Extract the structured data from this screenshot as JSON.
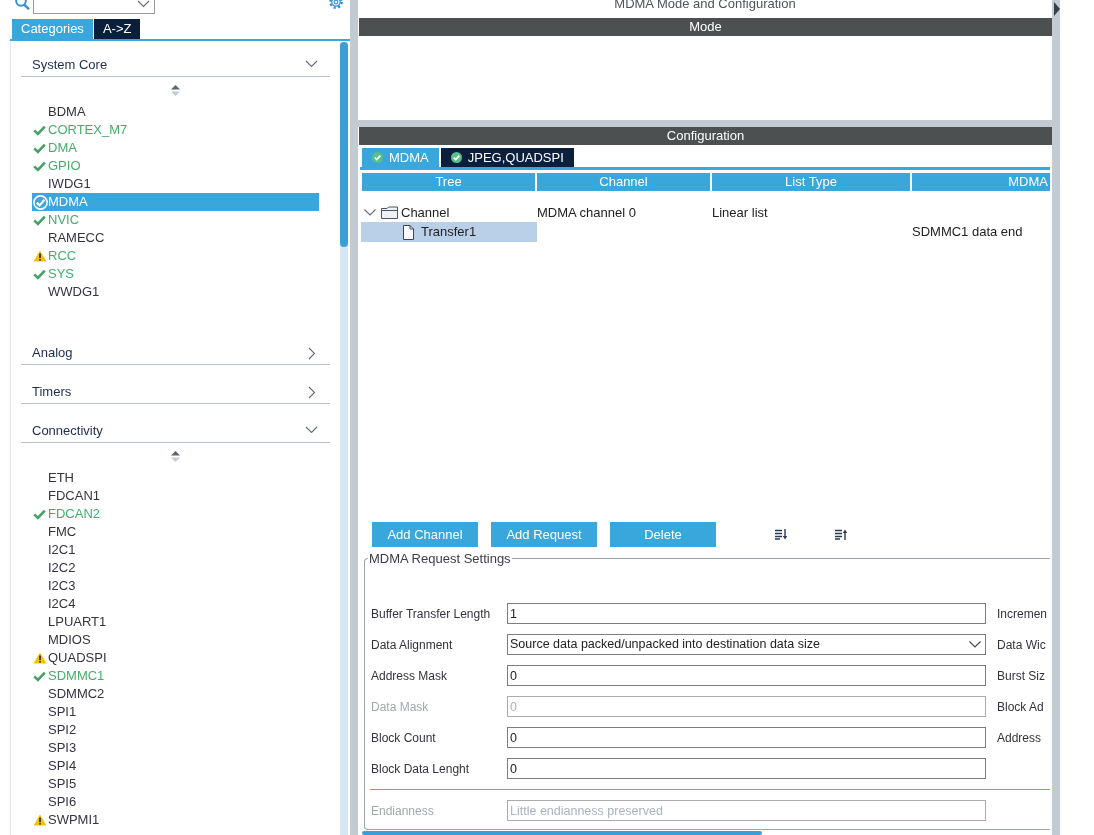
{
  "sidebar": {
    "tabs": [
      {
        "label": "Categories",
        "selected": true
      },
      {
        "label": "A->Z",
        "selected": false
      }
    ],
    "categories": [
      {
        "label": "System Core",
        "expanded": true,
        "items": [
          {
            "label": "BDMA",
            "checked": false,
            "warning": false,
            "configured": false,
            "selected": false
          },
          {
            "label": "CORTEX_M7",
            "checked": true,
            "warning": false,
            "configured": true,
            "selected": false
          },
          {
            "label": "DMA",
            "checked": true,
            "warning": false,
            "configured": true,
            "selected": false
          },
          {
            "label": "GPIO",
            "checked": true,
            "warning": false,
            "configured": true,
            "selected": false
          },
          {
            "label": "IWDG1",
            "checked": false,
            "warning": false,
            "configured": false,
            "selected": false
          },
          {
            "label": "MDMA",
            "checked": true,
            "warning": false,
            "configured": true,
            "selected": true
          },
          {
            "label": "NVIC",
            "checked": true,
            "warning": false,
            "configured": true,
            "selected": false
          },
          {
            "label": "RAMECC",
            "checked": false,
            "warning": false,
            "configured": false,
            "selected": false
          },
          {
            "label": "RCC",
            "warning": true,
            "configured": true,
            "selected": false
          },
          {
            "label": "SYS",
            "checked": true,
            "warning": false,
            "configured": true,
            "selected": false
          },
          {
            "label": "WWDG1",
            "checked": false,
            "warning": false,
            "configured": false,
            "selected": false
          }
        ]
      },
      {
        "label": "Analog",
        "expanded": false
      },
      {
        "label": "Timers",
        "expanded": false
      },
      {
        "label": "Connectivity",
        "expanded": true,
        "items": [
          {
            "label": "ETH",
            "checked": false,
            "warning": false,
            "configured": false,
            "selected": false
          },
          {
            "label": "FDCAN1",
            "checked": false,
            "warning": false,
            "configured": false,
            "selected": false
          },
          {
            "label": "FDCAN2",
            "checked": true,
            "warning": false,
            "configured": true,
            "selected": false
          },
          {
            "label": "FMC",
            "checked": false,
            "warning": false,
            "configured": false,
            "selected": false
          },
          {
            "label": "I2C1",
            "checked": false,
            "warning": false,
            "configured": false,
            "selected": false
          },
          {
            "label": "I2C2",
            "checked": false,
            "warning": false,
            "configured": false,
            "selected": false
          },
          {
            "label": "I2C3",
            "checked": false,
            "warning": false,
            "configured": false,
            "selected": false
          },
          {
            "label": "I2C4",
            "checked": false,
            "warning": false,
            "configured": false,
            "selected": false
          },
          {
            "label": "LPUART1",
            "checked": false,
            "warning": false,
            "configured": false,
            "selected": false
          },
          {
            "label": "MDIOS",
            "checked": false,
            "warning": false,
            "configured": false,
            "selected": false
          },
          {
            "label": "QUADSPI",
            "warning": true,
            "configured": false,
            "selected": false
          },
          {
            "label": "SDMMC1",
            "checked": true,
            "warning": false,
            "configured": true,
            "selected": false
          },
          {
            "label": "SDMMC2",
            "checked": false,
            "warning": false,
            "configured": false,
            "selected": false
          },
          {
            "label": "SPI1",
            "checked": false,
            "warning": false,
            "configured": false,
            "selected": false
          },
          {
            "label": "SPI2",
            "checked": false,
            "warning": false,
            "configured": false,
            "selected": false
          },
          {
            "label": "SPI3",
            "checked": false,
            "warning": false,
            "configured": false,
            "selected": false
          },
          {
            "label": "SPI4",
            "checked": false,
            "warning": false,
            "configured": false,
            "selected": false
          },
          {
            "label": "SPI5",
            "checked": false,
            "warning": false,
            "configured": false,
            "selected": false
          },
          {
            "label": "SPI6",
            "checked": false,
            "warning": false,
            "configured": false,
            "selected": false
          },
          {
            "label": "SWPMI1",
            "warning": true,
            "configured": false,
            "selected": false
          }
        ]
      }
    ]
  },
  "main": {
    "title": "MDMA Mode and Configuration",
    "mode": {
      "title": "Mode"
    },
    "configuration": {
      "title": "Configuration",
      "tabs": [
        {
          "label": "MDMA",
          "selected": true
        },
        {
          "label": "JPEG,QUADSPI",
          "selected": false
        }
      ],
      "table": {
        "columns": [
          "Tree",
          "Channel",
          "List Type",
          "MDMA"
        ],
        "rows": [
          {
            "tree": "Channel",
            "channel": "MDMA channel 0",
            "list_type": "Linear list",
            "expanded": true,
            "selected": false,
            "children": [
              {
                "tree": "Transfer1",
                "column_4": "SDMMC1 data end",
                "selected": true
              }
            ]
          }
        ]
      },
      "buttons": [
        "Add Channel",
        "Add Request",
        "Delete"
      ],
      "request_settings": {
        "title": "MDMA Request Settings",
        "groups": [
          {
            "fields": [
              {
                "label": "Buffer Transfer Length",
                "value": "1",
                "kind": "input",
                "disabled": false,
                "side_label": "Incremen"
              },
              {
                "label": "Data Alignment",
                "value": "Source data packed/unpacked into destination data size",
                "kind": "dropdown",
                "disabled": false,
                "side_label": "Data Wic"
              },
              {
                "label": "Address Mask",
                "value": "0",
                "kind": "input",
                "disabled": false,
                "side_label": "Burst Siz"
              },
              {
                "label": "Data Mask",
                "value": "0",
                "kind": "input",
                "disabled": true,
                "side_label": "Block Ad"
              },
              {
                "label": "Block Count",
                "value": "0",
                "kind": "input",
                "disabled": false,
                "side_label": "Address"
              },
              {
                "label": "Block Data Lenght",
                "value": "0",
                "kind": "input",
                "disabled": false
              }
            ]
          },
          {
            "fields": [
              {
                "label": "Endianness",
                "value": "Little endianness preserved",
                "kind": "input",
                "disabled": true
              }
            ]
          }
        ]
      }
    }
  }
}
